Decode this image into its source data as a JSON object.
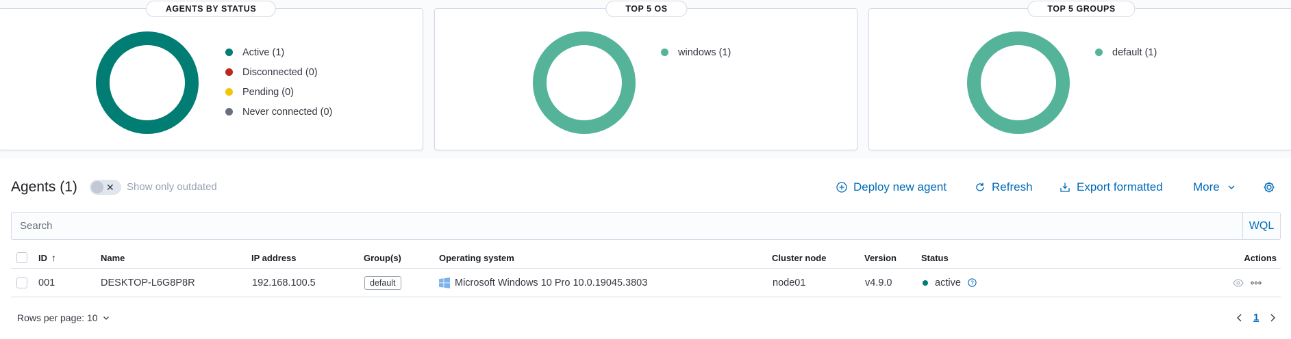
{
  "panels": {
    "status": {
      "title": "AGENTS BY STATUS",
      "ring_color": "#017d73",
      "legend": [
        {
          "label": "Active (1)",
          "color": "#017d73"
        },
        {
          "label": "Disconnected (0)",
          "color": "#bd271e"
        },
        {
          "label": "Pending (0)",
          "color": "#f5c500"
        },
        {
          "label": "Never connected (0)",
          "color": "#69707d"
        }
      ]
    },
    "os": {
      "title": "TOP 5 OS",
      "ring_color": "#54b399",
      "legend": [
        {
          "label": "windows (1)",
          "color": "#54b399"
        }
      ]
    },
    "groups": {
      "title": "TOP 5 GROUPS",
      "ring_color": "#54b399",
      "legend": [
        {
          "label": "default (1)",
          "color": "#54b399"
        }
      ]
    }
  },
  "agents": {
    "title": "Agents (1)",
    "outdated_toggle_label": "Show only outdated",
    "actions": {
      "deploy": "Deploy new agent",
      "refresh": "Refresh",
      "export": "Export formatted",
      "more": "More"
    },
    "search_placeholder": "Search",
    "wql": "WQL",
    "columns": {
      "id": "ID",
      "name": "Name",
      "ip": "IP address",
      "groups": "Group(s)",
      "os": "Operating system",
      "cluster": "Cluster node",
      "version": "Version",
      "status": "Status",
      "actions": "Actions"
    },
    "rows": [
      {
        "id": "001",
        "name": "DESKTOP-L6G8P8R",
        "ip": "192.168.100.5",
        "group": "default",
        "os": "Microsoft Windows 10 Pro 10.0.19045.3803",
        "os_icon": "windows-icon",
        "cluster": "node01",
        "version": "v4.9.0",
        "status": "active"
      }
    ],
    "rows_per_page": "Rows per page: 10",
    "current_page": "1"
  },
  "colors": {
    "accent": "#006bb8",
    "active": "#017d73",
    "chart": "#54b399"
  }
}
